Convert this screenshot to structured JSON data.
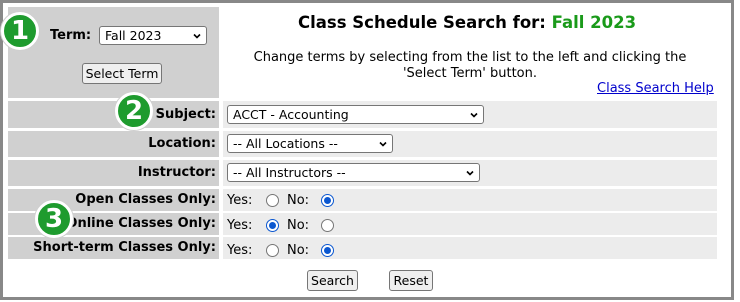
{
  "term": {
    "label": "Term:",
    "selected": "Fall 2023",
    "select_button": "Select Term"
  },
  "header": {
    "title_prefix": "Class Schedule Search for:",
    "title_term": "Fall 2023",
    "note": "Change terms by selecting from the list to the left and clicking the 'Select Term' button.",
    "help_link": "Class Search Help"
  },
  "filters": {
    "subject": {
      "label": "Subject:",
      "selected": "ACCT - Accounting"
    },
    "location": {
      "label": "Location:",
      "selected": "-- All Locations --"
    },
    "instructor": {
      "label": "Instructor:",
      "selected": "-- All Instructors --"
    }
  },
  "radios": {
    "yes": "Yes:",
    "no": "No:",
    "open": {
      "label": "Open Classes Only:",
      "value": "No"
    },
    "online": {
      "label": "Online Classes Only:",
      "value": "Yes"
    },
    "short_term": {
      "label": "Short-term Classes Only:",
      "value": "No"
    }
  },
  "actions": {
    "search": "Search",
    "reset": "Reset"
  },
  "steps": [
    "1",
    "2",
    "3"
  ],
  "colors": {
    "step_badge": "#1e9b2e",
    "term_highlight": "#1a9a1a",
    "link": "#0000cc",
    "radio_selected": "#0b57d0"
  }
}
